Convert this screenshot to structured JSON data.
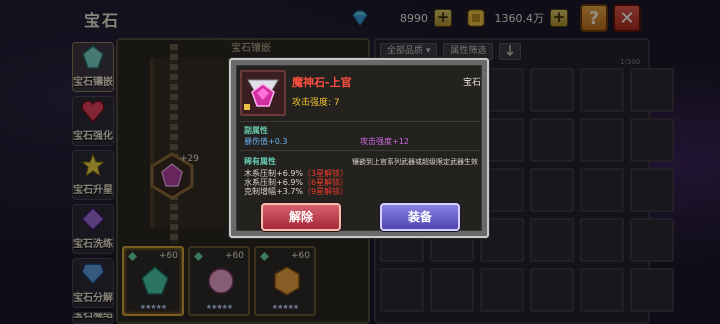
{
  "header": {
    "title": "宝石",
    "diamonds": "8990",
    "gold": "1360.4万",
    "help_label": "?",
    "close_label": "✕",
    "plus_label": "+"
  },
  "tabs": [
    {
      "label": "宝石镶嵌",
      "icon": "gem-inlay-icon",
      "color": "#7ad0c8"
    },
    {
      "label": "宝石强化",
      "icon": "gem-enhance-icon",
      "color": "#e2405a"
    },
    {
      "label": "宝石升星",
      "icon": "gem-star-icon",
      "color": "#e8d040"
    },
    {
      "label": "宝石洗练",
      "icon": "gem-refine-icon",
      "color": "#9a6ad8"
    },
    {
      "label": "宝石分解",
      "icon": "gem-decompose-icon",
      "color": "#5a9ad8"
    },
    {
      "label": "宝石凝结",
      "icon": "gem-condense-icon",
      "color": "#e2a040"
    }
  ],
  "main_panel": {
    "title": "宝石镶嵌",
    "socket_bonus": "+29",
    "slots": [
      {
        "bonus": "+60",
        "stars": "★★★★★",
        "color": "#4ac8a8"
      },
      {
        "bonus": "+60",
        "stars": "★★★★★",
        "color": "#e8a0c8"
      },
      {
        "bonus": "+60",
        "stars": "★★★★★",
        "color": "#e8a040"
      }
    ]
  },
  "inventory": {
    "filter_all": "全部品质 ▾",
    "filter_attr": "属性筛选",
    "sort_icon": "sort-icon",
    "count": "1/300"
  },
  "dialog": {
    "item_name": "魔神石-上官",
    "item_type": "宝石",
    "attack_strength": "攻击强度: 7",
    "sub_attr_title": "副属性",
    "sub_attrs": [
      {
        "text": "暴伤值+0.3",
        "color": "#6ab0f0"
      },
      {
        "text": "攻击强度+12",
        "color": "#d06ae6"
      }
    ],
    "rare_attr_title": "稀有属性",
    "rare_desc": "镶嵌到上官系列武器或超级限定武器生效",
    "rare_attrs": [
      {
        "text": "木系压制+6.9%",
        "req": "（3星解锁）"
      },
      {
        "text": "水系压制+6.9%",
        "req": "（6星解锁）"
      },
      {
        "text": "克制增幅+3.7%",
        "req": "（9星解锁）"
      }
    ],
    "remove_label": "解除",
    "equip_label": "装备"
  }
}
